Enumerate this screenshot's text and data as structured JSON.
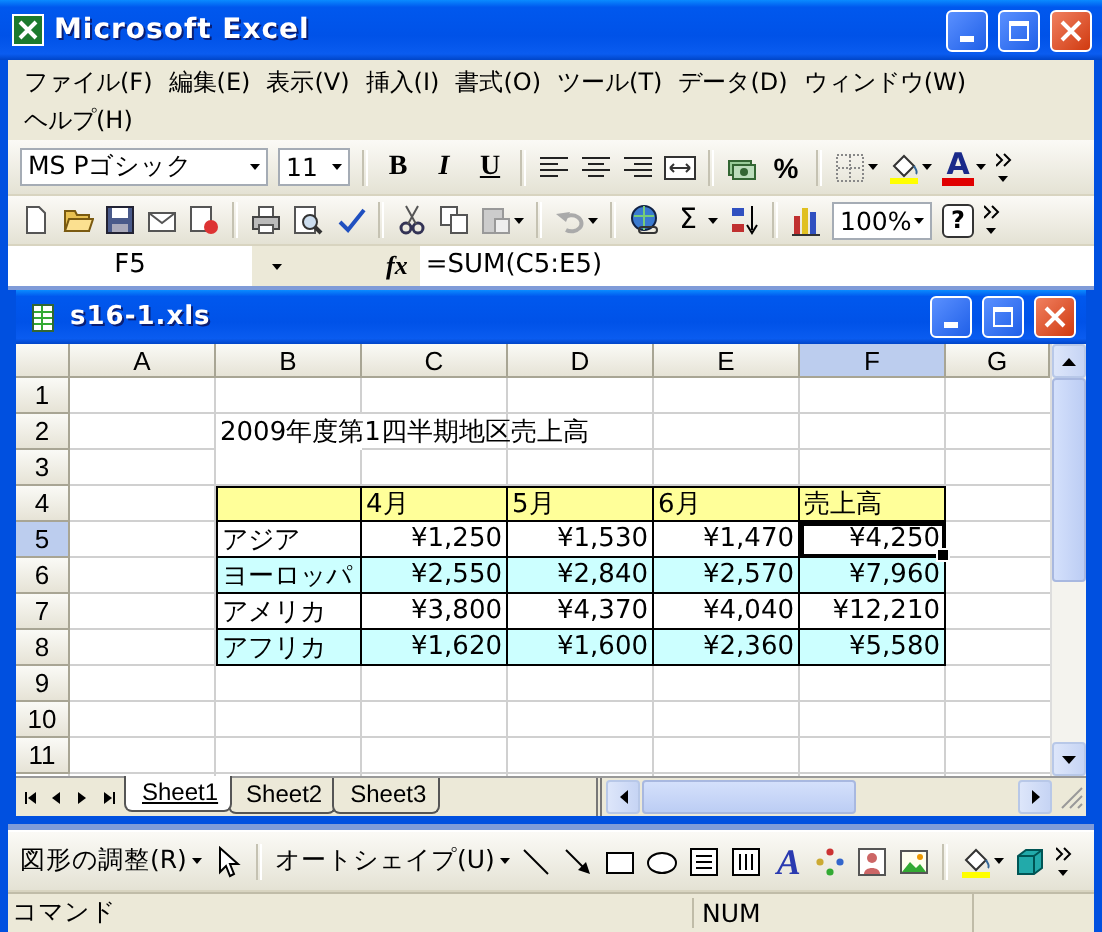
{
  "window": {
    "title": "Microsoft Excel"
  },
  "menu": [
    {
      "label": "ファイル(F)"
    },
    {
      "label": "編集(E)"
    },
    {
      "label": "表示(V)"
    },
    {
      "label": "挿入(I)"
    },
    {
      "label": "書式(O)"
    },
    {
      "label": "ツール(T)"
    },
    {
      "label": "データ(D)"
    },
    {
      "label": "ウィンドウ(W)"
    },
    {
      "label": "ヘルプ(H)"
    }
  ],
  "formatting_toolbar": {
    "font": "MS Pゴシック",
    "size": "11",
    "bold": "B",
    "italic": "I",
    "underline": "U",
    "percent": "%",
    "font_color": "A"
  },
  "standard_toolbar": {
    "autosum": "Σ",
    "zoom": "100%",
    "help": "?"
  },
  "formula_bar": {
    "name_box": "F5",
    "function_label": "fx",
    "formula": "=SUM(C5:E5)"
  },
  "workbook": {
    "title": "s16-1.xls",
    "columns": [
      {
        "label": "A",
        "selected": false
      },
      {
        "label": "B",
        "selected": false
      },
      {
        "label": "C",
        "selected": false
      },
      {
        "label": "D",
        "selected": false
      },
      {
        "label": "E",
        "selected": false
      },
      {
        "label": "F",
        "selected": true
      },
      {
        "label": "G",
        "selected": false
      }
    ],
    "rows": [
      {
        "header": "1",
        "selected": false,
        "kind": "blank"
      },
      {
        "header": "2",
        "selected": false,
        "kind": "title",
        "text": "2009年度第1四半期地区売上高"
      },
      {
        "header": "3",
        "selected": false,
        "kind": "blank"
      },
      {
        "header": "4",
        "selected": false,
        "kind": "header",
        "color": "#ffff99",
        "labels": [
          "4月",
          "5月",
          "6月",
          "売上高"
        ]
      },
      {
        "header": "5",
        "selected": true,
        "kind": "data",
        "color": "#ffffff",
        "region": "アジア",
        "values": [
          "¥1,250",
          "¥1,530",
          "¥1,470",
          "¥4,250"
        ]
      },
      {
        "header": "6",
        "selected": false,
        "kind": "data",
        "color": "#ccffff",
        "region": "ヨーロッパ",
        "values": [
          "¥2,550",
          "¥2,840",
          "¥2,570",
          "¥7,960"
        ]
      },
      {
        "header": "7",
        "selected": false,
        "kind": "data",
        "color": "#ffffff",
        "region": "アメリカ",
        "values": [
          "¥3,800",
          "¥4,370",
          "¥4,040",
          "¥12,210"
        ]
      },
      {
        "header": "8",
        "selected": false,
        "kind": "data",
        "color": "#ccffff",
        "region": "アフリカ",
        "values": [
          "¥1,620",
          "¥1,600",
          "¥2,360",
          "¥5,580"
        ]
      },
      {
        "header": "9",
        "selected": false,
        "kind": "blank"
      },
      {
        "header": "10",
        "selected": false,
        "kind": "blank"
      },
      {
        "header": "11",
        "selected": false,
        "kind": "blank"
      }
    ],
    "sheets": [
      {
        "label": "Sheet1",
        "selected": true
      },
      {
        "label": "Sheet2",
        "selected": false
      },
      {
        "label": "Sheet3",
        "selected": false
      }
    ]
  },
  "drawing_toolbar": {
    "draw_menu": "図形の調整(R)",
    "autoshapes_menu": "オートシェイプ(U)",
    "wordart": "A"
  },
  "status_bar": {
    "mode": "コマンド",
    "num_lock": "NUM"
  }
}
